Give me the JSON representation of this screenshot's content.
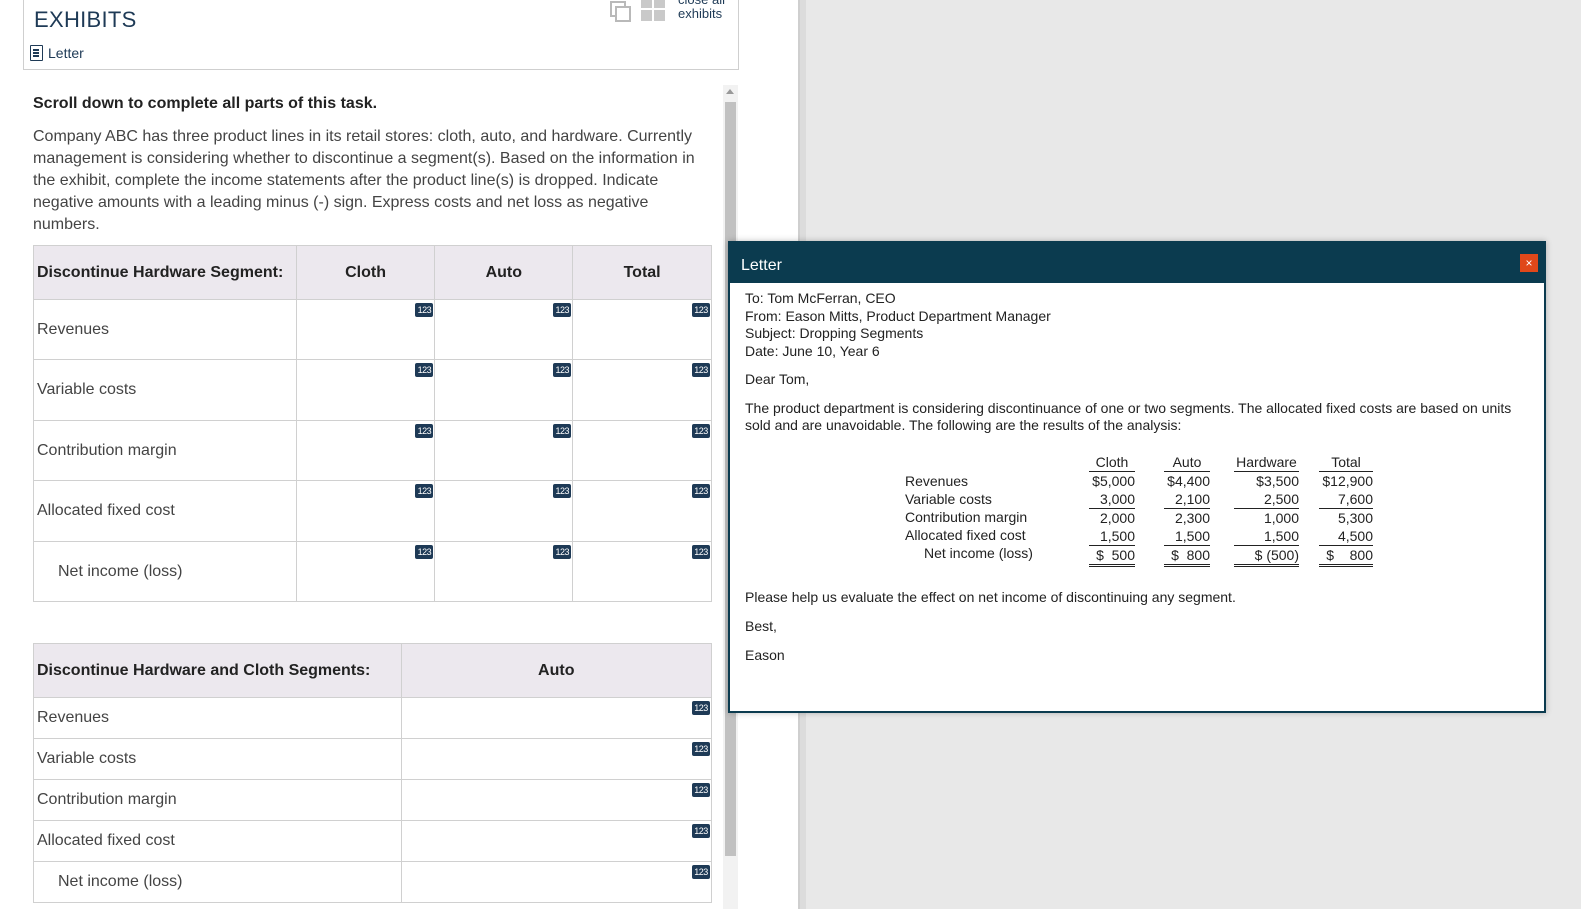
{
  "exhibits": {
    "title": "EXHIBITS",
    "letter_link": "Letter",
    "close_all": "close all exhibits"
  },
  "task": {
    "instruction": "Scroll down to complete all parts of this task.",
    "description": "Company ABC has three product lines in its retail stores: cloth, auto, and hardware. Currently management is considering whether to discontinue a segment(s). Based on the information in the exhibit, complete the income statements after the product line(s) is dropped. Indicate negative amounts with a leading minus (-) sign. Express costs and net loss as negative numbers."
  },
  "input_badge": "123",
  "table1": {
    "headers": [
      "Discontinue Hardware Segment:",
      "Cloth",
      "Auto",
      "Total"
    ],
    "rows": [
      "Revenues",
      "Variable costs",
      "Contribution margin",
      "Allocated fixed cost",
      "Net income (loss)"
    ]
  },
  "table2": {
    "headers": [
      "Discontinue Hardware and Cloth Segments:",
      "Auto"
    ],
    "rows": [
      "Revenues",
      "Variable costs",
      "Contribution margin",
      "Allocated fixed cost",
      "Net income (loss)"
    ]
  },
  "letter": {
    "title": "Letter",
    "close": "×",
    "to": "To: Tom McFerran, CEO",
    "from": "From: Eason Mitts, Product Department Manager",
    "subject": "Subject: Dropping Segments",
    "date": "Date: June 10, Year 6",
    "greeting": "Dear Tom,",
    "body": "The product department is considering discontinuance of one or two segments. The allocated fixed costs are based on units sold and are unavoidable. The following are the results of the analysis:",
    "fin_rows": [
      "Revenues",
      "Variable costs",
      "Contribution margin",
      "Allocated fixed cost",
      "Net income (loss)"
    ],
    "fin_cols": [
      {
        "name": "Cloth",
        "values": [
          "$5,000",
          "3,000",
          "2,000",
          "1,500",
          "$  500"
        ]
      },
      {
        "name": "Auto",
        "values": [
          "$4,400",
          "2,100",
          "2,300",
          "1,500",
          "$  800"
        ]
      },
      {
        "name": "Hardware",
        "values": [
          "$3,500",
          "2,500",
          "1,000",
          "1,500",
          "$ (500)"
        ]
      },
      {
        "name": "Total",
        "values": [
          "$12,900",
          "7,600",
          "5,300",
          "4,500",
          "$    800"
        ]
      }
    ],
    "closing": "Please help us evaluate the effect on net income of discontinuing any segment.",
    "signoff": "Best,",
    "signature": "Eason"
  }
}
